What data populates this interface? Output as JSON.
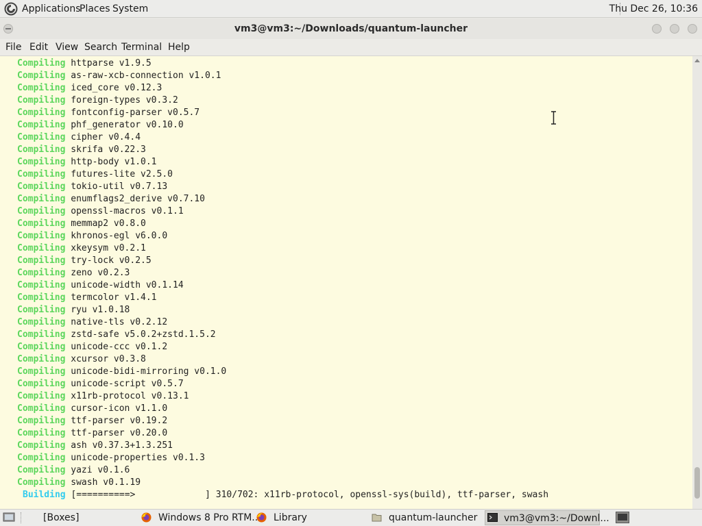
{
  "top_panel": {
    "menus": [
      "Applications",
      "Places",
      "System"
    ],
    "clock": "Thu Dec 26, 10:36"
  },
  "window": {
    "title": "vm3@vm3:~/Downloads/quantum-launcher"
  },
  "menubar": [
    "File",
    "Edit",
    "View",
    "Search",
    "Terminal",
    "Help"
  ],
  "terminal": {
    "keyword": "Compiling",
    "lines": [
      "httparse v1.9.5",
      "as-raw-xcb-connection v1.0.1",
      "iced_core v0.12.3",
      "foreign-types v0.3.2",
      "fontconfig-parser v0.5.7",
      "phf_generator v0.10.0",
      "cipher v0.4.4",
      "skrifa v0.22.3",
      "http-body v1.0.1",
      "futures-lite v2.5.0",
      "tokio-util v0.7.13",
      "enumflags2_derive v0.7.10",
      "openssl-macros v0.1.1",
      "memmap2 v0.8.0",
      "khronos-egl v6.0.0",
      "xkeysym v0.2.1",
      "try-lock v0.2.5",
      "zeno v0.2.3",
      "unicode-width v0.1.14",
      "termcolor v1.4.1",
      "ryu v1.0.18",
      "native-tls v0.2.12",
      "zstd-safe v5.0.2+zstd.1.5.2",
      "unicode-ccc v0.1.2",
      "xcursor v0.3.8",
      "unicode-bidi-mirroring v0.1.0",
      "unicode-script v0.5.7",
      "x11rb-protocol v0.13.1",
      "cursor-icon v1.1.0",
      "ttf-parser v0.19.2",
      "ttf-parser v0.20.0",
      "ash v0.37.3+1.3.251",
      "unicode-properties v0.1.3",
      "yazi v0.1.6",
      "swash v0.1.19"
    ],
    "building_label": "Building",
    "building_progress": "[==========>             ] 310/702: x11rb-protocol, openssl-sys(build), ttf-parser, swash"
  },
  "taskbar": {
    "items": [
      {
        "label": "[Boxes]",
        "icon": "boxes-icon"
      },
      {
        "label": "Windows 8 Pro RTM...",
        "icon": "firefox-icon"
      },
      {
        "label": "Library",
        "icon": "firefox-icon"
      },
      {
        "label": "quantum-launcher",
        "icon": "folder-icon"
      },
      {
        "label": "vm3@vm3:~/Downl...",
        "icon": "terminal-icon"
      }
    ]
  },
  "colors": {
    "compiling": "#5cd65c",
    "building": "#33ccee",
    "terminal_bg": "#fdfbe0"
  }
}
